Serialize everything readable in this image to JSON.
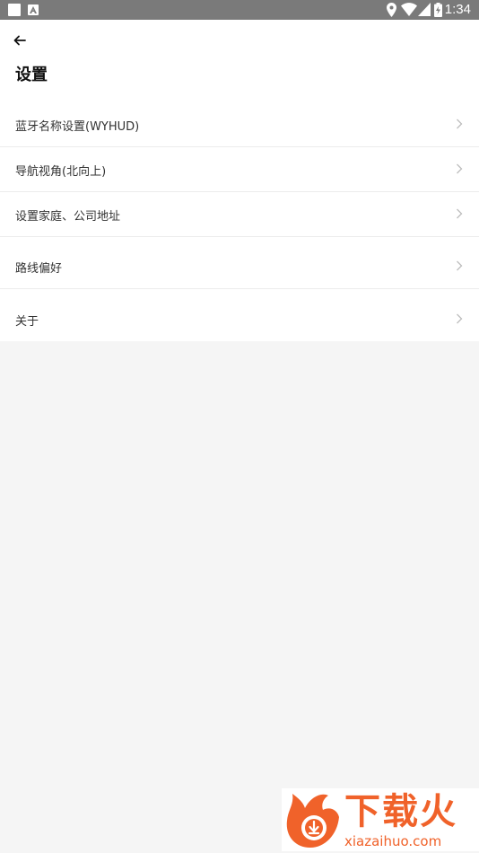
{
  "status_bar": {
    "time": "1:34",
    "icons": [
      "notification-square-icon",
      "notification-a-icon",
      "location-icon",
      "wifi-icon",
      "signal-icon",
      "battery-charging-icon"
    ]
  },
  "header": {
    "back_icon": "arrow-left-icon",
    "title": "设置"
  },
  "settings": {
    "items": [
      {
        "label": "蓝牙名称设置(WYHUD)"
      },
      {
        "label": "导航视角(北向上)"
      },
      {
        "label": "设置家庭、公司地址"
      },
      {
        "label": "路线偏好"
      },
      {
        "label": "关于"
      }
    ]
  },
  "watermark": {
    "cn": "下载火",
    "en": "xiazaihuo.com",
    "color": "#f0622a"
  },
  "colors": {
    "status_bar": "#7a7a7a",
    "background": "#f5f5f5",
    "list_bg": "#ffffff",
    "chevron": "#bdbdbd"
  }
}
